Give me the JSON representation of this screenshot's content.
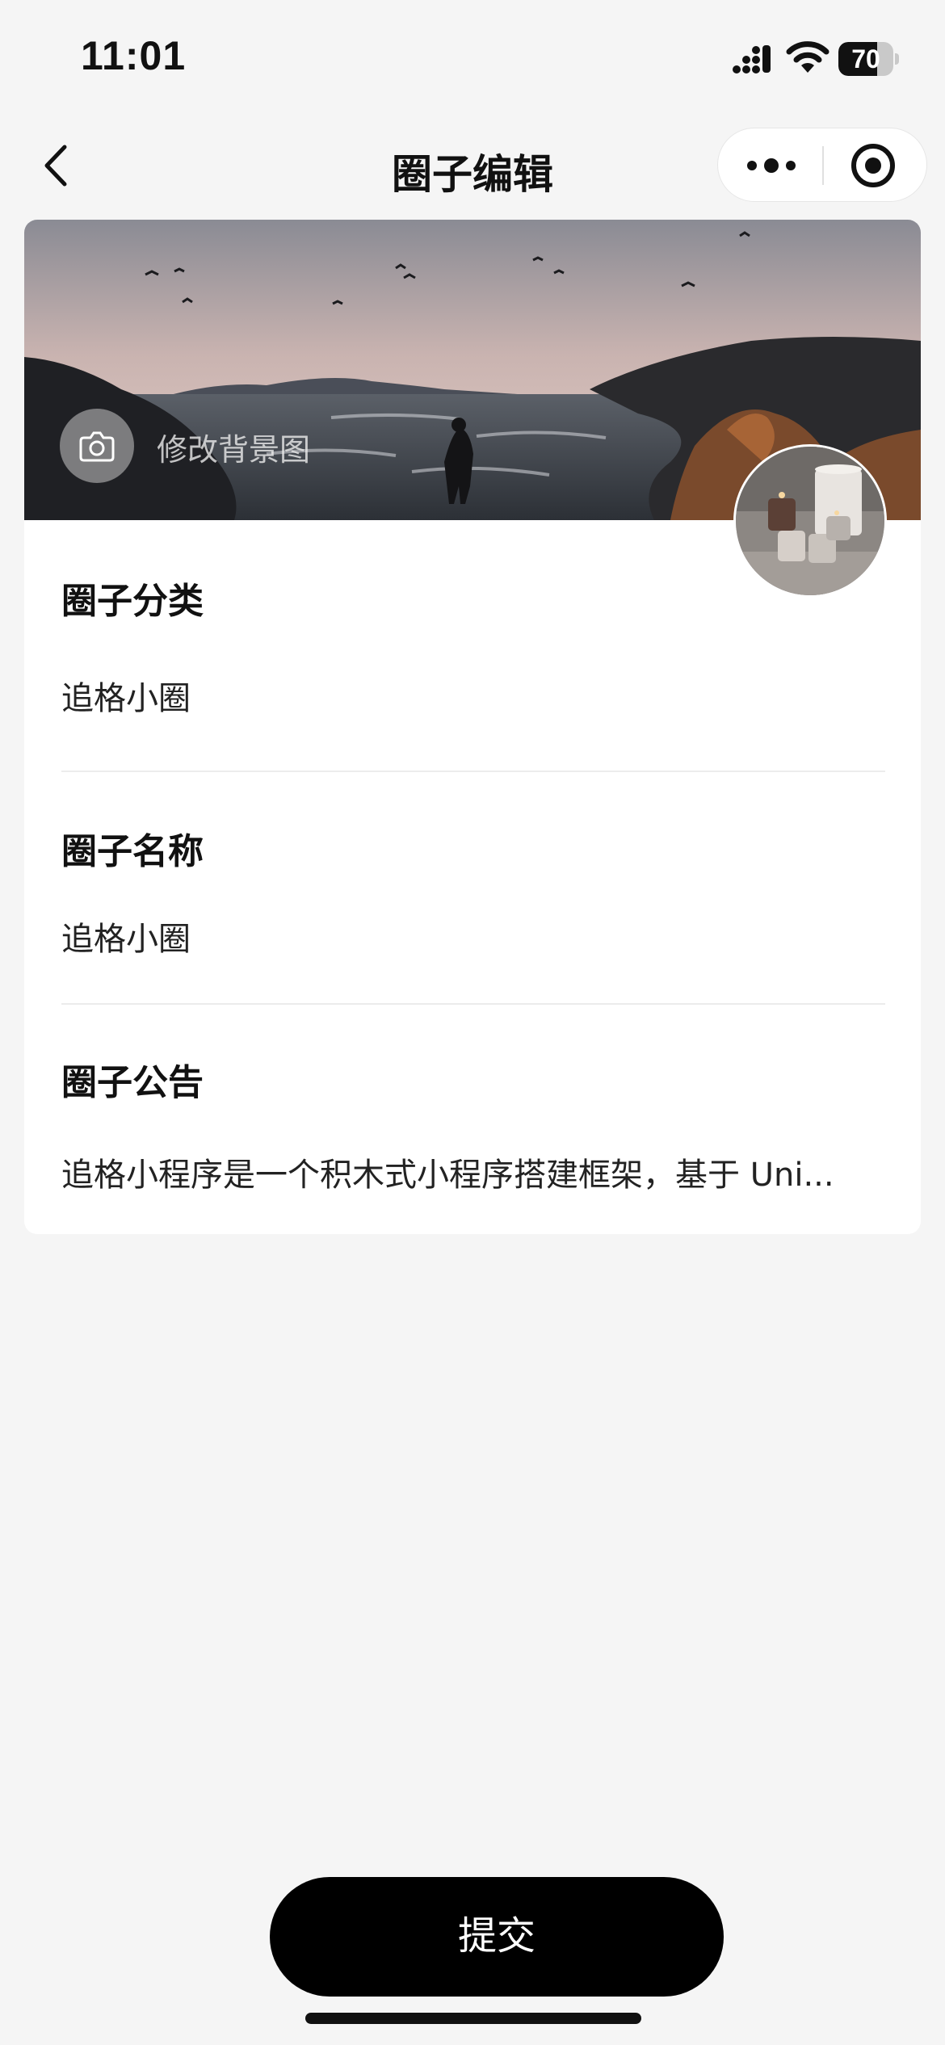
{
  "status_bar": {
    "time": "11:01",
    "battery_level": 70,
    "battery_text": "70",
    "icons": [
      "signal-icon",
      "wifi-icon",
      "battery-icon"
    ]
  },
  "nav": {
    "title": "圈子编辑",
    "back_icon": "chevron-left-icon",
    "more_icon": "more-dots-icon",
    "close_icon": "target-close-icon"
  },
  "banner": {
    "change_background_label": "修改背景图",
    "camera_icon": "camera-icon"
  },
  "fields": [
    {
      "label": "圈子分类",
      "value": "追格小圈"
    },
    {
      "label": "圈子名称",
      "value": "追格小圈"
    },
    {
      "label": "圈子公告",
      "value": "追格小程序是一个积木式小程序搭建框架，基于 Uni..."
    }
  ],
  "submit": {
    "label": "提交"
  },
  "colors": {
    "background": "#f5f5f5",
    "card": "#ffffff",
    "primary_button": "#000000"
  }
}
